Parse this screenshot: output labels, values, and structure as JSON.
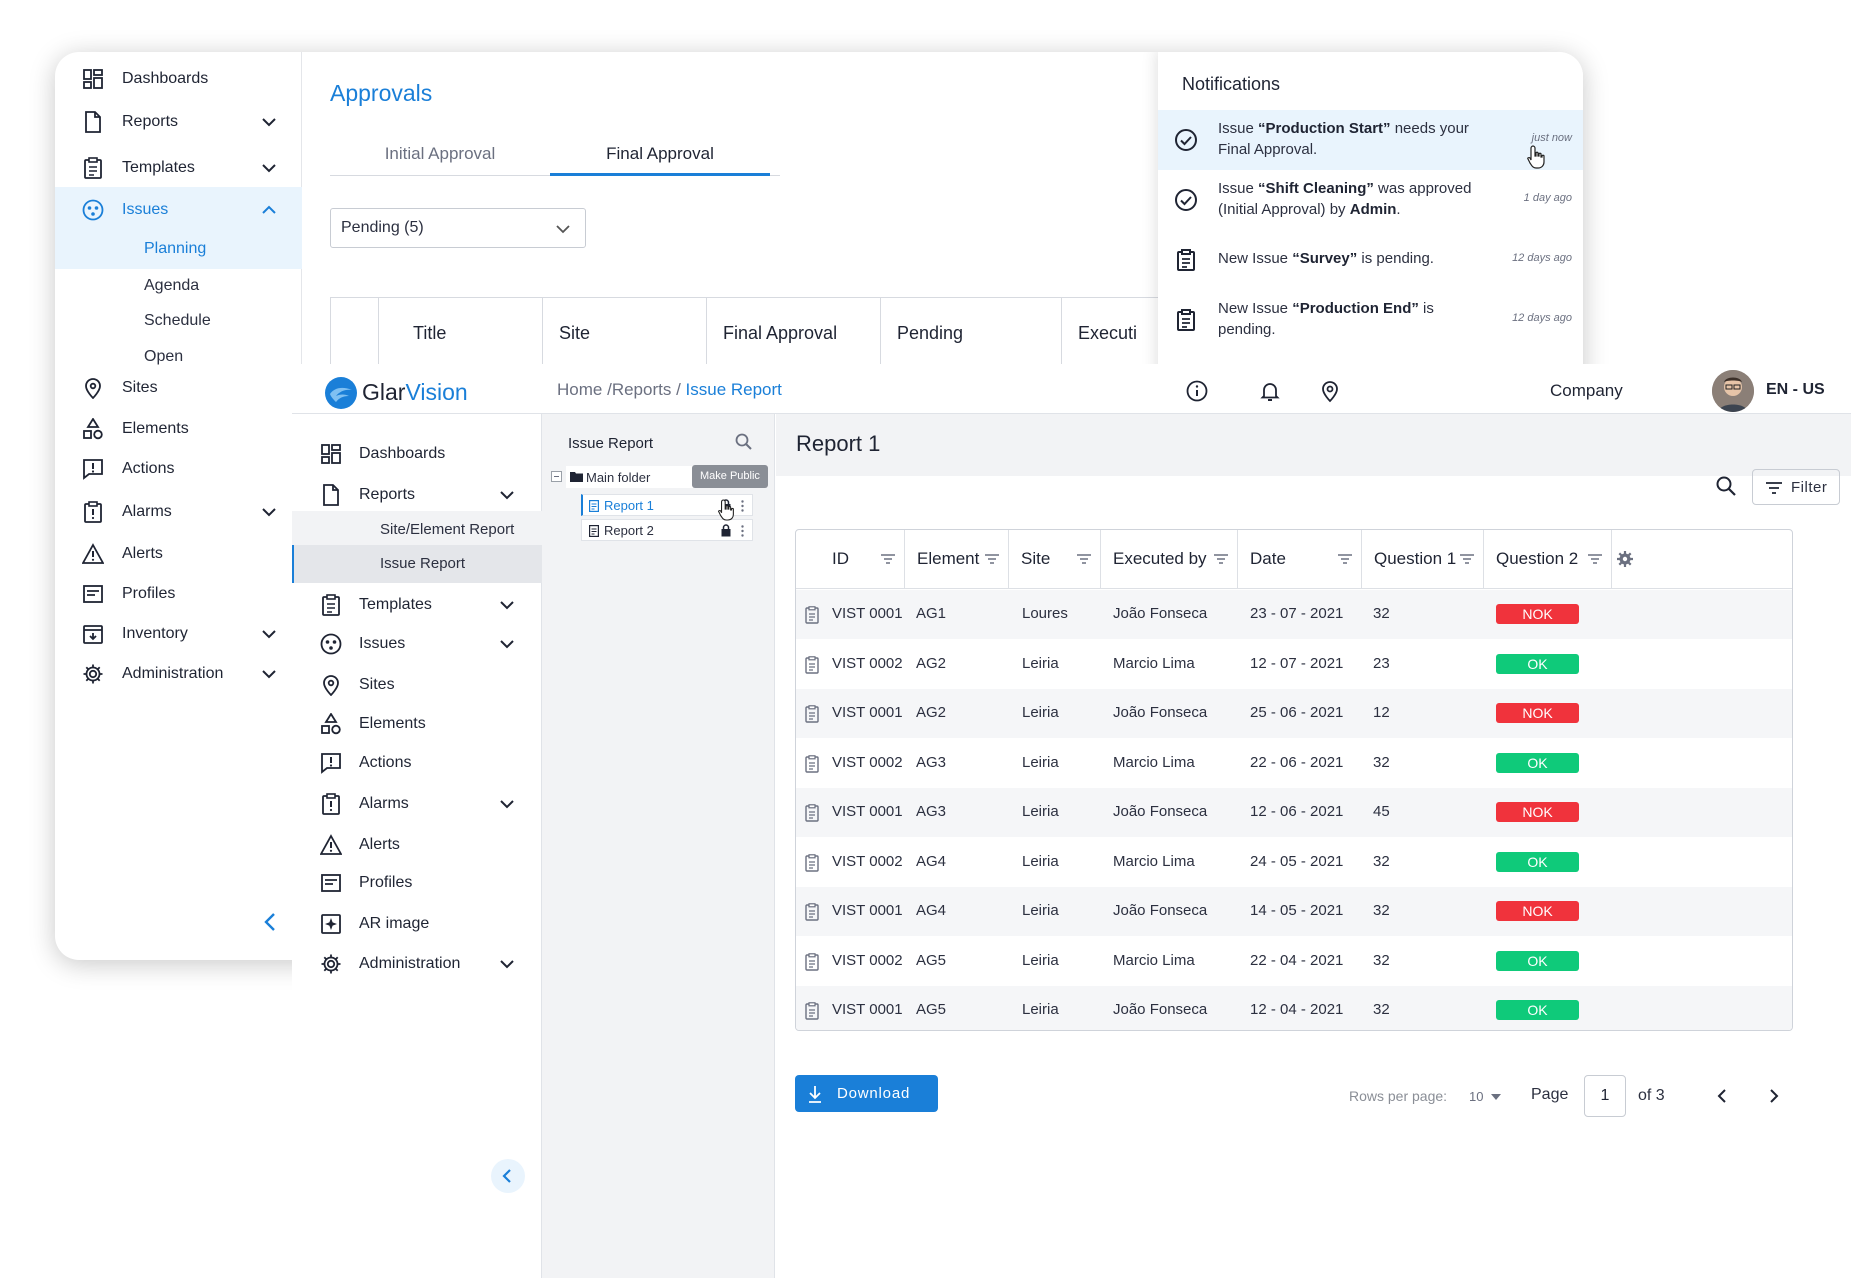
{
  "back_window": {
    "sidebar": [
      {
        "label": "Dashboards",
        "icon": "dashboard-icon"
      },
      {
        "label": "Reports",
        "icon": "document-icon"
      },
      {
        "label": "Templates",
        "icon": "clipboard-icon"
      },
      {
        "label": "Issues",
        "icon": "issues-icon"
      },
      {
        "label": "Sites",
        "icon": "location-pin-icon"
      },
      {
        "label": "Elements",
        "icon": "shapes-icon"
      },
      {
        "label": "Actions",
        "icon": "exclamation-chat-icon"
      },
      {
        "label": "Alarms",
        "icon": "alarm-clipboard-icon"
      },
      {
        "label": "Alerts",
        "icon": "warning-triangle-icon"
      },
      {
        "label": "Profiles",
        "icon": "profile-card-icon"
      },
      {
        "label": "Inventory",
        "icon": "inventory-box-icon"
      },
      {
        "label": "Administration",
        "icon": "gear-icon"
      }
    ],
    "issues_subitems": [
      "Planning",
      "Agenda",
      "Schedule",
      "Open"
    ],
    "title": "Approvals",
    "tabs": [
      "Initial Approval",
      "Final Approval"
    ],
    "status_select": "Pending (5)",
    "table_headers": [
      "Title",
      "Site",
      "Final Approval",
      "Pending",
      "Executi"
    ],
    "notifications": {
      "title": "Notifications",
      "items": [
        {
          "pre": "Issue ",
          "bold": "“Production Start”",
          "post": " needs your Final Approval.",
          "time": "just now"
        },
        {
          "pre": "Issue ",
          "bold": "“Shift Cleaning”",
          "post": " was approved (Initial Approval) by ",
          "bold2": "Admin",
          "post2": ".",
          "time": "1 day ago"
        },
        {
          "pre": "New Issue ",
          "bold": "“Survey”",
          "post": " is pending.",
          "time": "12 days ago"
        },
        {
          "pre": "New Issue ",
          "bold": "“Production End”",
          "post": " is pending.",
          "time": "12 days ago"
        }
      ]
    }
  },
  "front_window": {
    "logo": {
      "part1": "Glar",
      "part2": "Vision"
    },
    "breadcrumb": {
      "home": "Home",
      "sep1": " /",
      "reports": "Reports",
      "sep2": " / ",
      "current": "Issue Report"
    },
    "company": "Company",
    "language": "EN - US",
    "sidebar": [
      {
        "label": "Dashboards"
      },
      {
        "label": "Reports"
      },
      {
        "label": "Templates"
      },
      {
        "label": "Issues"
      },
      {
        "label": "Sites"
      },
      {
        "label": "Elements"
      },
      {
        "label": "Actions"
      },
      {
        "label": "Alarms"
      },
      {
        "label": "Alerts"
      },
      {
        "label": "Profiles"
      },
      {
        "label": "AR image"
      },
      {
        "label": "Administration"
      }
    ],
    "reports_subitems": [
      "Site/Element Report",
      "Issue Report"
    ],
    "tree": {
      "title": "Issue Report",
      "folder": "Main folder",
      "items": [
        "Report 1",
        "Report 2"
      ],
      "tooltip": "Make Public"
    },
    "report_title": "Report 1",
    "filter_label": "Filter",
    "table": {
      "headers": [
        "ID",
        "Element",
        "Site",
        "Executed by",
        "Date",
        "Question 1",
        "Question 2"
      ],
      "rows": [
        {
          "id": "VIST 0001",
          "element": "AG1",
          "site": "Loures",
          "executed_by": "João Fonseca",
          "date": "23 - 07 - 2021",
          "q1": "32",
          "q2": "NOK"
        },
        {
          "id": "VIST 0002",
          "element": "AG2",
          "site": "Leiria",
          "executed_by": "Marcio Lima",
          "date": "12 - 07 - 2021",
          "q1": "23",
          "q2": "OK"
        },
        {
          "id": "VIST 0001",
          "element": "AG2",
          "site": "Leiria",
          "executed_by": "João Fonseca",
          "date": "25 - 06 - 2021",
          "q1": "12",
          "q2": "NOK"
        },
        {
          "id": "VIST 0002",
          "element": "AG3",
          "site": "Leiria",
          "executed_by": "Marcio Lima",
          "date": "22 - 06 - 2021",
          "q1": "32",
          "q2": "OK"
        },
        {
          "id": "VIST 0001",
          "element": "AG3",
          "site": "Leiria",
          "executed_by": "João Fonseca",
          "date": "12 - 06 - 2021",
          "q1": "45",
          "q2": "NOK"
        },
        {
          "id": "VIST 0002",
          "element": "AG4",
          "site": "Leiria",
          "executed_by": "Marcio Lima",
          "date": "24 - 05 - 2021",
          "q1": "32",
          "q2": "OK"
        },
        {
          "id": "VIST 0001",
          "element": "AG4",
          "site": "Leiria",
          "executed_by": "João Fonseca",
          "date": "14 - 05 - 2021",
          "q1": "32",
          "q2": "NOK"
        },
        {
          "id": "VIST 0002",
          "element": "AG5",
          "site": "Leiria",
          "executed_by": "Marcio Lima",
          "date": "22 - 04 - 2021",
          "q1": "32",
          "q2": "OK"
        },
        {
          "id": "VIST 0001",
          "element": "AG5",
          "site": "Leiria",
          "executed_by": "João Fonseca",
          "date": "12 - 04 - 2021",
          "q1": "32",
          "q2": "OK"
        }
      ]
    },
    "download_label": "Download",
    "pagination": {
      "rows_per_page_label": "Rows per page:",
      "rows_per_page": "10",
      "page_label": "Page",
      "page": "1",
      "of_label": "of 3"
    }
  },
  "colors": {
    "accent": "#1a7fd8",
    "nok": "#f0333c",
    "ok": "#0fca7a",
    "active_bg": "#e9f4fd"
  }
}
